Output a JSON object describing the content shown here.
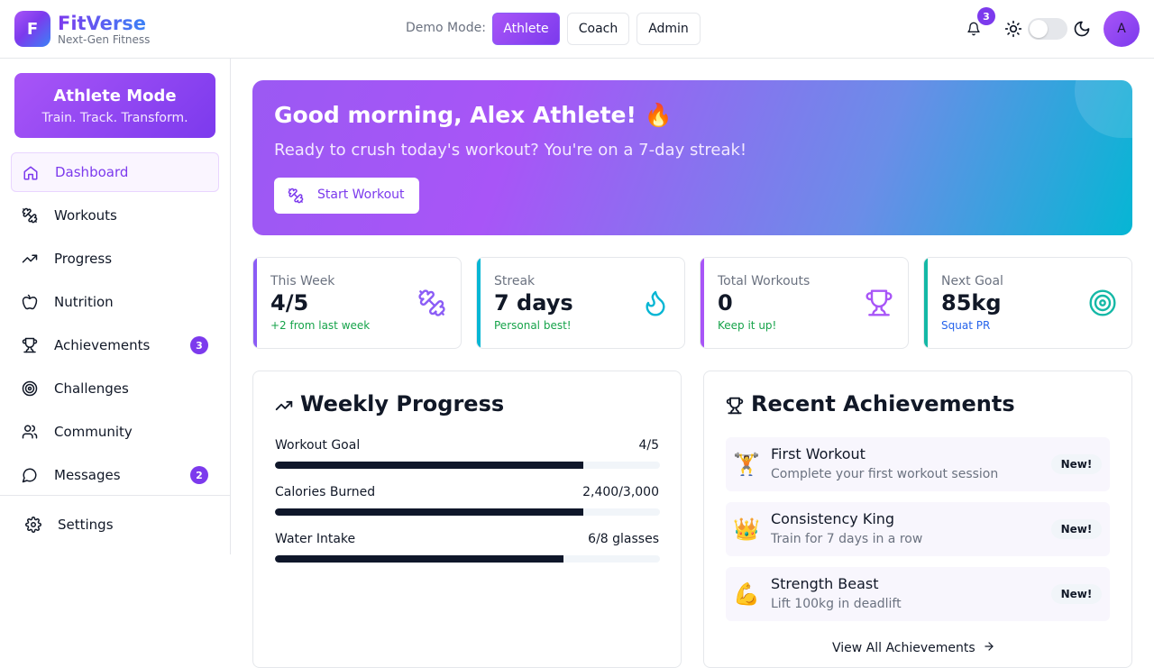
{
  "header": {
    "logo_letter": "F",
    "brand": "FitVerse",
    "tagline": "Next-Gen Fitness",
    "demo_label": "Demo Mode:",
    "modes": [
      "Athlete",
      "Coach",
      "Admin"
    ],
    "active_mode": "Athlete",
    "notification_count": "3",
    "avatar_initial": "A"
  },
  "sidebar": {
    "mode_title": "Athlete Mode",
    "mode_subtitle": "Train. Track. Transform.",
    "items": [
      {
        "label": "Dashboard",
        "icon": "home-icon",
        "active": true
      },
      {
        "label": "Workouts",
        "icon": "dumbbell-icon"
      },
      {
        "label": "Progress",
        "icon": "trending-up-icon"
      },
      {
        "label": "Nutrition",
        "icon": "apple-icon"
      },
      {
        "label": "Achievements",
        "icon": "trophy-icon",
        "badge": "3"
      },
      {
        "label": "Challenges",
        "icon": "target-icon"
      },
      {
        "label": "Community",
        "icon": "users-icon"
      },
      {
        "label": "Messages",
        "icon": "message-icon",
        "badge": "2"
      }
    ],
    "settings_label": "Settings"
  },
  "hero": {
    "greeting": "Good morning, Alex Athlete! 🔥",
    "subtitle": "Ready to crush today's workout? You're on a 7-day streak!",
    "button_label": "Start Workout"
  },
  "stats": [
    {
      "label": "This Week",
      "value": "4/5",
      "note": "+2 from last week",
      "color": "#8b5cf6",
      "note_color": "#16a34a",
      "icon": "dumbbell-icon"
    },
    {
      "label": "Streak",
      "value": "7 days",
      "note": "Personal best!",
      "color": "#06b6d4",
      "note_color": "#16a34a",
      "icon": "flame-icon"
    },
    {
      "label": "Total Workouts",
      "value": "0",
      "note": "Keep it up!",
      "color": "#a855f7",
      "note_color": "#16a34a",
      "icon": "trophy-icon"
    },
    {
      "label": "Next Goal",
      "value": "85kg",
      "note": "Squat PR",
      "color": "#14b8a6",
      "note_color": "#2563eb",
      "icon": "target-icon"
    }
  ],
  "weekly_progress": {
    "title": "Weekly Progress",
    "items": [
      {
        "label": "Workout Goal",
        "value": "4/5",
        "fraction": 0.8
      },
      {
        "label": "Calories Burned",
        "value": "2,400/3,000",
        "fraction": 0.8
      },
      {
        "label": "Water Intake",
        "value": "6/8 glasses",
        "fraction": 0.75
      }
    ]
  },
  "achievements": {
    "title": "Recent Achievements",
    "items": [
      {
        "emoji": "🏋️",
        "title": "First Workout",
        "desc": "Complete your first workout session",
        "badge": "New!"
      },
      {
        "emoji": "👑",
        "title": "Consistency King",
        "desc": "Train for 7 days in a row",
        "badge": "New!"
      },
      {
        "emoji": "💪",
        "title": "Strength Beast",
        "desc": "Lift 100kg in deadlift",
        "badge": "New!"
      }
    ],
    "view_all": "View All Achievements"
  }
}
